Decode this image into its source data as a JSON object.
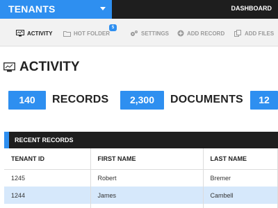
{
  "topbar": {
    "tenant_select": "TENANTS",
    "dashboard": "DASHBOARD"
  },
  "toolbar": {
    "items": [
      {
        "label": "ACTIVITY",
        "icon": "monitor-icon",
        "active": true
      },
      {
        "label": "HOT FOLDER",
        "icon": "folder-icon",
        "badge": "5"
      },
      {
        "label": "SETTINGS",
        "icon": "gears-icon"
      },
      {
        "label": "ADD RECORD",
        "icon": "plus-circle-icon"
      },
      {
        "label": "ADD FILES",
        "icon": "files-icon"
      }
    ]
  },
  "page": {
    "title": "ACTIVITY",
    "title_icon": "monitor-chart-icon"
  },
  "stats": [
    {
      "value": "140",
      "label": "RECORDS"
    },
    {
      "value": "2,300",
      "label": "DOCUMENTS"
    },
    {
      "value": "12",
      "label": ""
    }
  ],
  "recent_records": {
    "title": "RECENT RECORDS",
    "columns": [
      "TENANT ID",
      "FIRST NAME",
      "LAST NAME"
    ],
    "rows": [
      [
        "1245",
        "Robert",
        "Bremer"
      ],
      [
        "1244",
        "James",
        "Cambell"
      ]
    ]
  },
  "colors": {
    "accent": "#2e8ff0",
    "dark": "#1e1e1e",
    "row_highlight": "#d6e8fb"
  }
}
